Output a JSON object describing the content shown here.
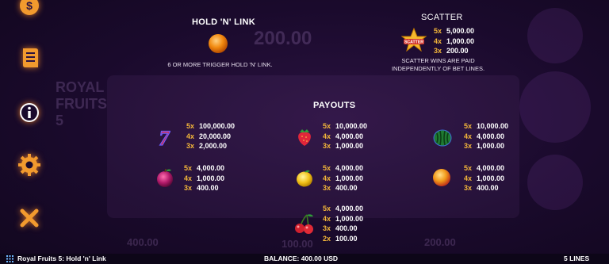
{
  "sidebar": {
    "buttons": [
      {
        "name": "coin-icon",
        "label": "Bet"
      },
      {
        "name": "paytable-icon",
        "label": "Paytable"
      },
      {
        "name": "info-icon",
        "label": "Info"
      },
      {
        "name": "settings-icon",
        "label": "Settings"
      },
      {
        "name": "close-icon",
        "label": "Close"
      }
    ]
  },
  "hold_n_link": {
    "title": "HOLD 'N' LINK",
    "description": "6 OR MORE TRIGGER HOLD 'N' LINK."
  },
  "scatter": {
    "title": "SCATTER",
    "badge": "SCATTER",
    "pays": [
      {
        "n": "5x",
        "v": "5,000.00"
      },
      {
        "n": "4x",
        "v": "1,000.00"
      },
      {
        "n": "3x",
        "v": "200.00"
      }
    ],
    "note_line1": "SCATTER WINS ARE PAID",
    "note_line2": "INDEPENDENTLY OF BET LINES."
  },
  "payouts": {
    "title": "PAYOUTS",
    "seven": [
      {
        "n": "5x",
        "v": "100,000.00"
      },
      {
        "n": "4x",
        "v": "20,000.00"
      },
      {
        "n": "3x",
        "v": "2,000.00"
      }
    ],
    "strawberry": [
      {
        "n": "5x",
        "v": "10,000.00"
      },
      {
        "n": "4x",
        "v": "4,000.00"
      },
      {
        "n": "3x",
        "v": "1,000.00"
      }
    ],
    "watermelon": [
      {
        "n": "5x",
        "v": "10,000.00"
      },
      {
        "n": "4x",
        "v": "4,000.00"
      },
      {
        "n": "3x",
        "v": "1,000.00"
      }
    ],
    "plum": [
      {
        "n": "5x",
        "v": "4,000.00"
      },
      {
        "n": "4x",
        "v": "1,000.00"
      },
      {
        "n": "3x",
        "v": "400.00"
      }
    ],
    "lemon": [
      {
        "n": "5x",
        "v": "4,000.00"
      },
      {
        "n": "4x",
        "v": "1,000.00"
      },
      {
        "n": "3x",
        "v": "400.00"
      }
    ],
    "orange": [
      {
        "n": "5x",
        "v": "4,000.00"
      },
      {
        "n": "4x",
        "v": "1,000.00"
      },
      {
        "n": "3x",
        "v": "400.00"
      }
    ],
    "cherry": [
      {
        "n": "5x",
        "v": "4,000.00"
      },
      {
        "n": "4x",
        "v": "1,000.00"
      },
      {
        "n": "3x",
        "v": "400.00"
      },
      {
        "n": "2x",
        "v": "100.00"
      }
    ]
  },
  "bottom": {
    "game_title": "Royal Fruits 5: Hold 'n' Link",
    "balance": "BALANCE: 400.00 USD",
    "lines": "5 LINES"
  },
  "colors": {
    "multiplier": "#f3b63a",
    "accent_glow": "#ff8c28",
    "background": "#1a0a2c"
  }
}
